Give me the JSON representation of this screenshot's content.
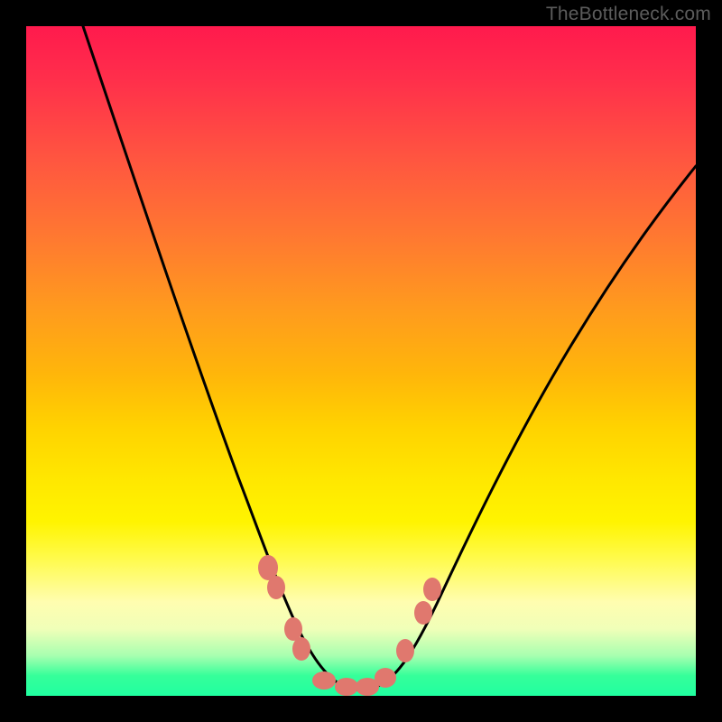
{
  "watermark": "TheBottleneck.com",
  "colors": {
    "point": "#e0786e",
    "line": "#000000",
    "gradient_top": "#ff1a4d",
    "gradient_bottom": "#20ffa0"
  },
  "chart_data": {
    "type": "line",
    "title": "",
    "xlabel": "",
    "ylabel": "",
    "xlim": [
      0,
      100
    ],
    "ylim": [
      0,
      100
    ],
    "x": [
      10,
      15,
      20,
      25,
      30,
      33,
      36,
      38,
      40,
      42,
      44,
      46,
      48,
      50,
      52,
      55,
      58,
      62,
      68,
      75,
      82,
      90,
      100
    ],
    "values": [
      100,
      86,
      71,
      56,
      41,
      31,
      22,
      15,
      9,
      5,
      2,
      1,
      1,
      1,
      2,
      4,
      8,
      14,
      24,
      35,
      46,
      57,
      70
    ],
    "annotations": [
      {
        "x": 36,
        "y": 18,
        "label": ""
      },
      {
        "x": 37,
        "y": 15,
        "label": ""
      },
      {
        "x": 40,
        "y": 6,
        "label": ""
      },
      {
        "x": 42,
        "y": 3,
        "label": ""
      },
      {
        "x": 45,
        "y": 1,
        "label": ""
      },
      {
        "x": 48,
        "y": 1,
        "label": ""
      },
      {
        "x": 51,
        "y": 1,
        "label": ""
      },
      {
        "x": 53,
        "y": 3,
        "label": ""
      },
      {
        "x": 56,
        "y": 6,
        "label": ""
      },
      {
        "x": 59,
        "y": 14,
        "label": ""
      },
      {
        "x": 60,
        "y": 17,
        "label": ""
      }
    ],
    "grid": false,
    "legend": false
  }
}
